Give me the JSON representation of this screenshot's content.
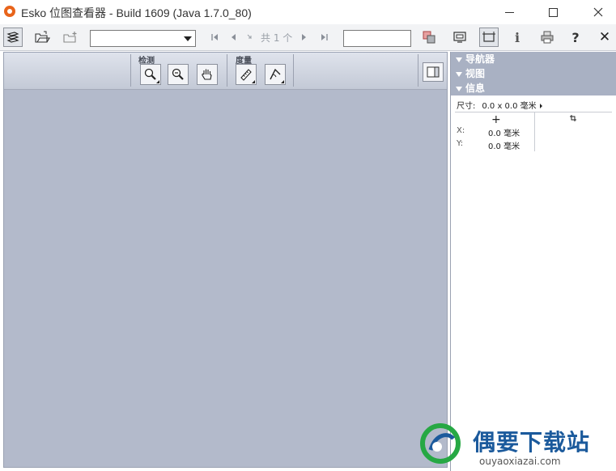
{
  "window": {
    "title": "Esko 位图查看器 - Build 1609 (Java 1.7.0_80)",
    "minimize_icon": "minimize-icon",
    "maximize_icon": "maximize-icon",
    "close_icon": "close-icon"
  },
  "toolbar": {
    "layers_icon": "layers-icon",
    "open_icon": "open-folder-icon",
    "open_new_icon": "open-new-folder-icon",
    "file_select_value": "",
    "first_icon": "first-page-icon",
    "prev_icon": "previous-page-icon",
    "page_count_text": "共 1 个",
    "next_icon": "next-page-icon",
    "last_icon": "last-page-icon",
    "page_input_value": "",
    "color_icon": "color-separations-icon",
    "print_preview_icon": "monitor-icon",
    "frame_icon": "frame-icon",
    "info_symbol": "i",
    "print_icon": "printer-icon",
    "help_symbol": "?",
    "close_symbol": "✕"
  },
  "canvas": {
    "inspect_group_label": "检测",
    "measure_group_label": "度量",
    "zoom_in_icon": "zoom-in-icon",
    "zoom_out_icon": "zoom-out-icon",
    "hand_icon": "hand-icon",
    "ruler_icon": "ruler-icon",
    "angle_icon": "angle-icon",
    "panel_toggle_icon": "panel-toggle-icon",
    "background_color": "#b3bacb"
  },
  "side_panel": {
    "navigator_label": "导航器",
    "view_label": "视图",
    "info_label": "信息",
    "size_label": "尺寸:",
    "size_value": "0.0 x 0.0 毫米",
    "cross_symbol": "+",
    "x_label": "X:",
    "x_value": "0.0 毫米",
    "y_label": "Y:",
    "y_value": "0.0 毫米",
    "header_color": "#a9b1c3"
  },
  "watermark": {
    "title": "偶要下载站",
    "url": "ouyaoxiazai.com"
  }
}
